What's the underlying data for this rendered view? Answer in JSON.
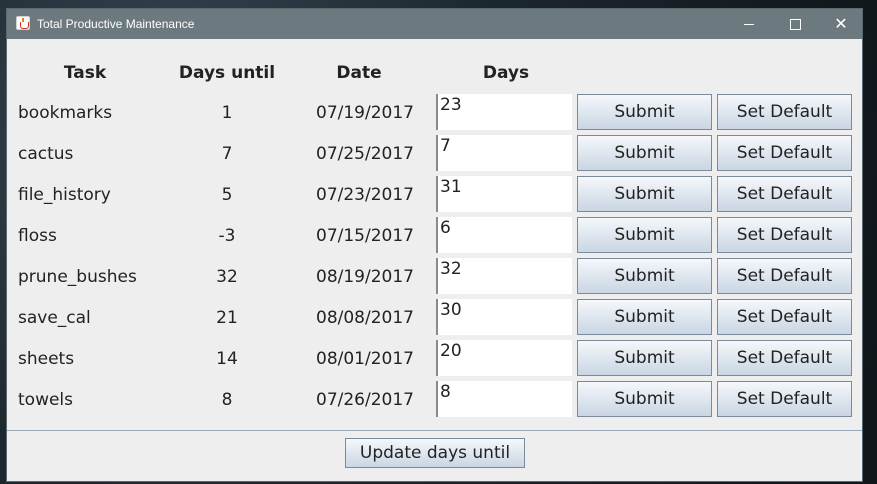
{
  "window": {
    "title": "Total Productive Maintenance",
    "controls": {
      "minimize": "minimize-icon",
      "maximize": "maximize-icon",
      "close": "✕"
    }
  },
  "table": {
    "headers": {
      "task": "Task",
      "days_until": "Days until",
      "date": "Date",
      "days": "Days"
    },
    "rows": [
      {
        "task": "bookmarks",
        "days_until": "1",
        "date": "07/19/2017",
        "days": "23"
      },
      {
        "task": "cactus",
        "days_until": "7",
        "date": "07/25/2017",
        "days": "7"
      },
      {
        "task": "file_history",
        "days_until": "5",
        "date": "07/23/2017",
        "days": "31"
      },
      {
        "task": "floss",
        "days_until": "-3",
        "date": "07/15/2017",
        "days": "6"
      },
      {
        "task": "prune_bushes",
        "days_until": "32",
        "date": "08/19/2017",
        "days": "32"
      },
      {
        "task": "save_cal",
        "days_until": "21",
        "date": "08/08/2017",
        "days": "30"
      },
      {
        "task": "sheets",
        "days_until": "14",
        "date": "08/01/2017",
        "days": "20"
      },
      {
        "task": "towels",
        "days_until": "8",
        "date": "07/26/2017",
        "days": "8"
      }
    ],
    "submit_label": "Submit",
    "default_label": "Set Default"
  },
  "footer": {
    "update_label": "Update days until"
  }
}
